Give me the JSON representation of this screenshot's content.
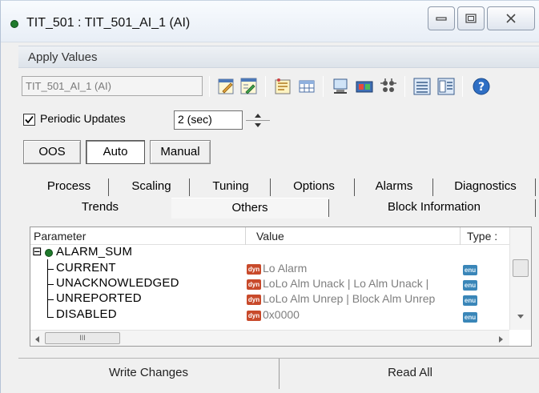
{
  "window": {
    "title": "TIT_501 : TIT_501_AI_1 (AI)",
    "status_color": "#1f7a2c"
  },
  "apply_values": {
    "label": "Apply Values"
  },
  "toolbar": {
    "tag_field_value": "TIT_501_AI_1 (AI)",
    "icons": [
      "edit-icon",
      "edit-all-icon",
      "properties-icon",
      "table-icon",
      "monitor-icon",
      "transfer-icon",
      "settings-icon",
      "list-view-icon",
      "detail-view-icon",
      "help-icon"
    ]
  },
  "periodic": {
    "label": "Periodic Updates",
    "checked": true,
    "interval_value": "2 (sec)"
  },
  "modes": {
    "oos": "OOS",
    "auto": "Auto",
    "manual": "Manual",
    "selected": "Auto"
  },
  "tabs": {
    "row1": [
      "Process",
      "Scaling",
      "Tuning",
      "Options",
      "Alarms",
      "Diagnostics"
    ],
    "row2": [
      "Trends",
      "Others",
      "Block Information"
    ],
    "active": "Others"
  },
  "grid": {
    "columns": {
      "parameter": "Parameter",
      "value": "Value",
      "type": "Type :"
    },
    "group": {
      "expand_symbol": "⊟",
      "name": "ALARM_SUM"
    },
    "rows": [
      {
        "name": "CURRENT",
        "value": "Lo Alarm",
        "value_badge": "dyn",
        "type_badge": "enu"
      },
      {
        "name": "UNACKNOWLEDGED",
        "value": "LoLo Alm Unack | Lo Alm Unack |",
        "value_badge": "dyn",
        "type_badge": "enu"
      },
      {
        "name": "UNREPORTED",
        "value": "LoLo Alm Unrep | Block Alm Unrep",
        "value_badge": "dyn",
        "type_badge": "enu"
      },
      {
        "name": "DISABLED",
        "value": "0x0000",
        "value_badge": "dyn",
        "type_badge": "enu"
      }
    ],
    "hscroll_thumb_label": "III"
  },
  "buttons": {
    "write_changes": "Write Changes",
    "read_all": "Read All"
  },
  "colors": {
    "value_text": "#7f7f7f",
    "dyn_badge": "#c84a2b",
    "enu_badge": "#3a86b8"
  }
}
